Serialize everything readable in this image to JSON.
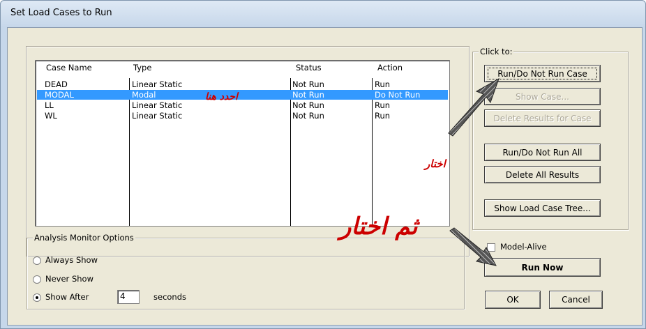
{
  "window": {
    "title": "Set Load Cases to Run"
  },
  "cases_table": {
    "headers": {
      "case_name": "Case Name",
      "type": "Type",
      "status": "Status",
      "action": "Action"
    },
    "rows": [
      {
        "case_name": "DEAD",
        "type": "Linear Static",
        "status": "Not Run",
        "action": "Run",
        "selected": false
      },
      {
        "case_name": "MODAL",
        "type": "Modal",
        "status": "Not Run",
        "action": "Do Not Run",
        "selected": true
      },
      {
        "case_name": "LL",
        "type": "Linear Static",
        "status": "Not Run",
        "action": "Run",
        "selected": false
      },
      {
        "case_name": "WL",
        "type": "Linear Static",
        "status": "Not Run",
        "action": "Run",
        "selected": false
      }
    ]
  },
  "click_to": {
    "legend": "Click to:",
    "run_do_not_run_case": "Run/Do Not Run Case",
    "show_case": "Show Case...",
    "delete_results_for_case": "Delete Results for Case",
    "run_do_not_run_all": "Run/Do Not Run All",
    "delete_all_results": "Delete All Results",
    "show_load_case_tree": "Show Load Case Tree..."
  },
  "analysis_monitor": {
    "legend": "Analysis Monitor Options",
    "always_show": "Always Show",
    "never_show": "Never Show",
    "show_after": "Show After",
    "seconds_value": "4",
    "seconds_label": "seconds",
    "selected_option": "show_after"
  },
  "run_panel": {
    "model_alive": "Model-Alive",
    "model_alive_checked": false,
    "run_now": "Run Now"
  },
  "footer": {
    "ok": "OK",
    "cancel": "Cancel"
  },
  "annotations": {
    "select_here": "احدد هنا",
    "choose": "اختار",
    "then_choose": "ثم اختار",
    "color": "#cc0000"
  }
}
